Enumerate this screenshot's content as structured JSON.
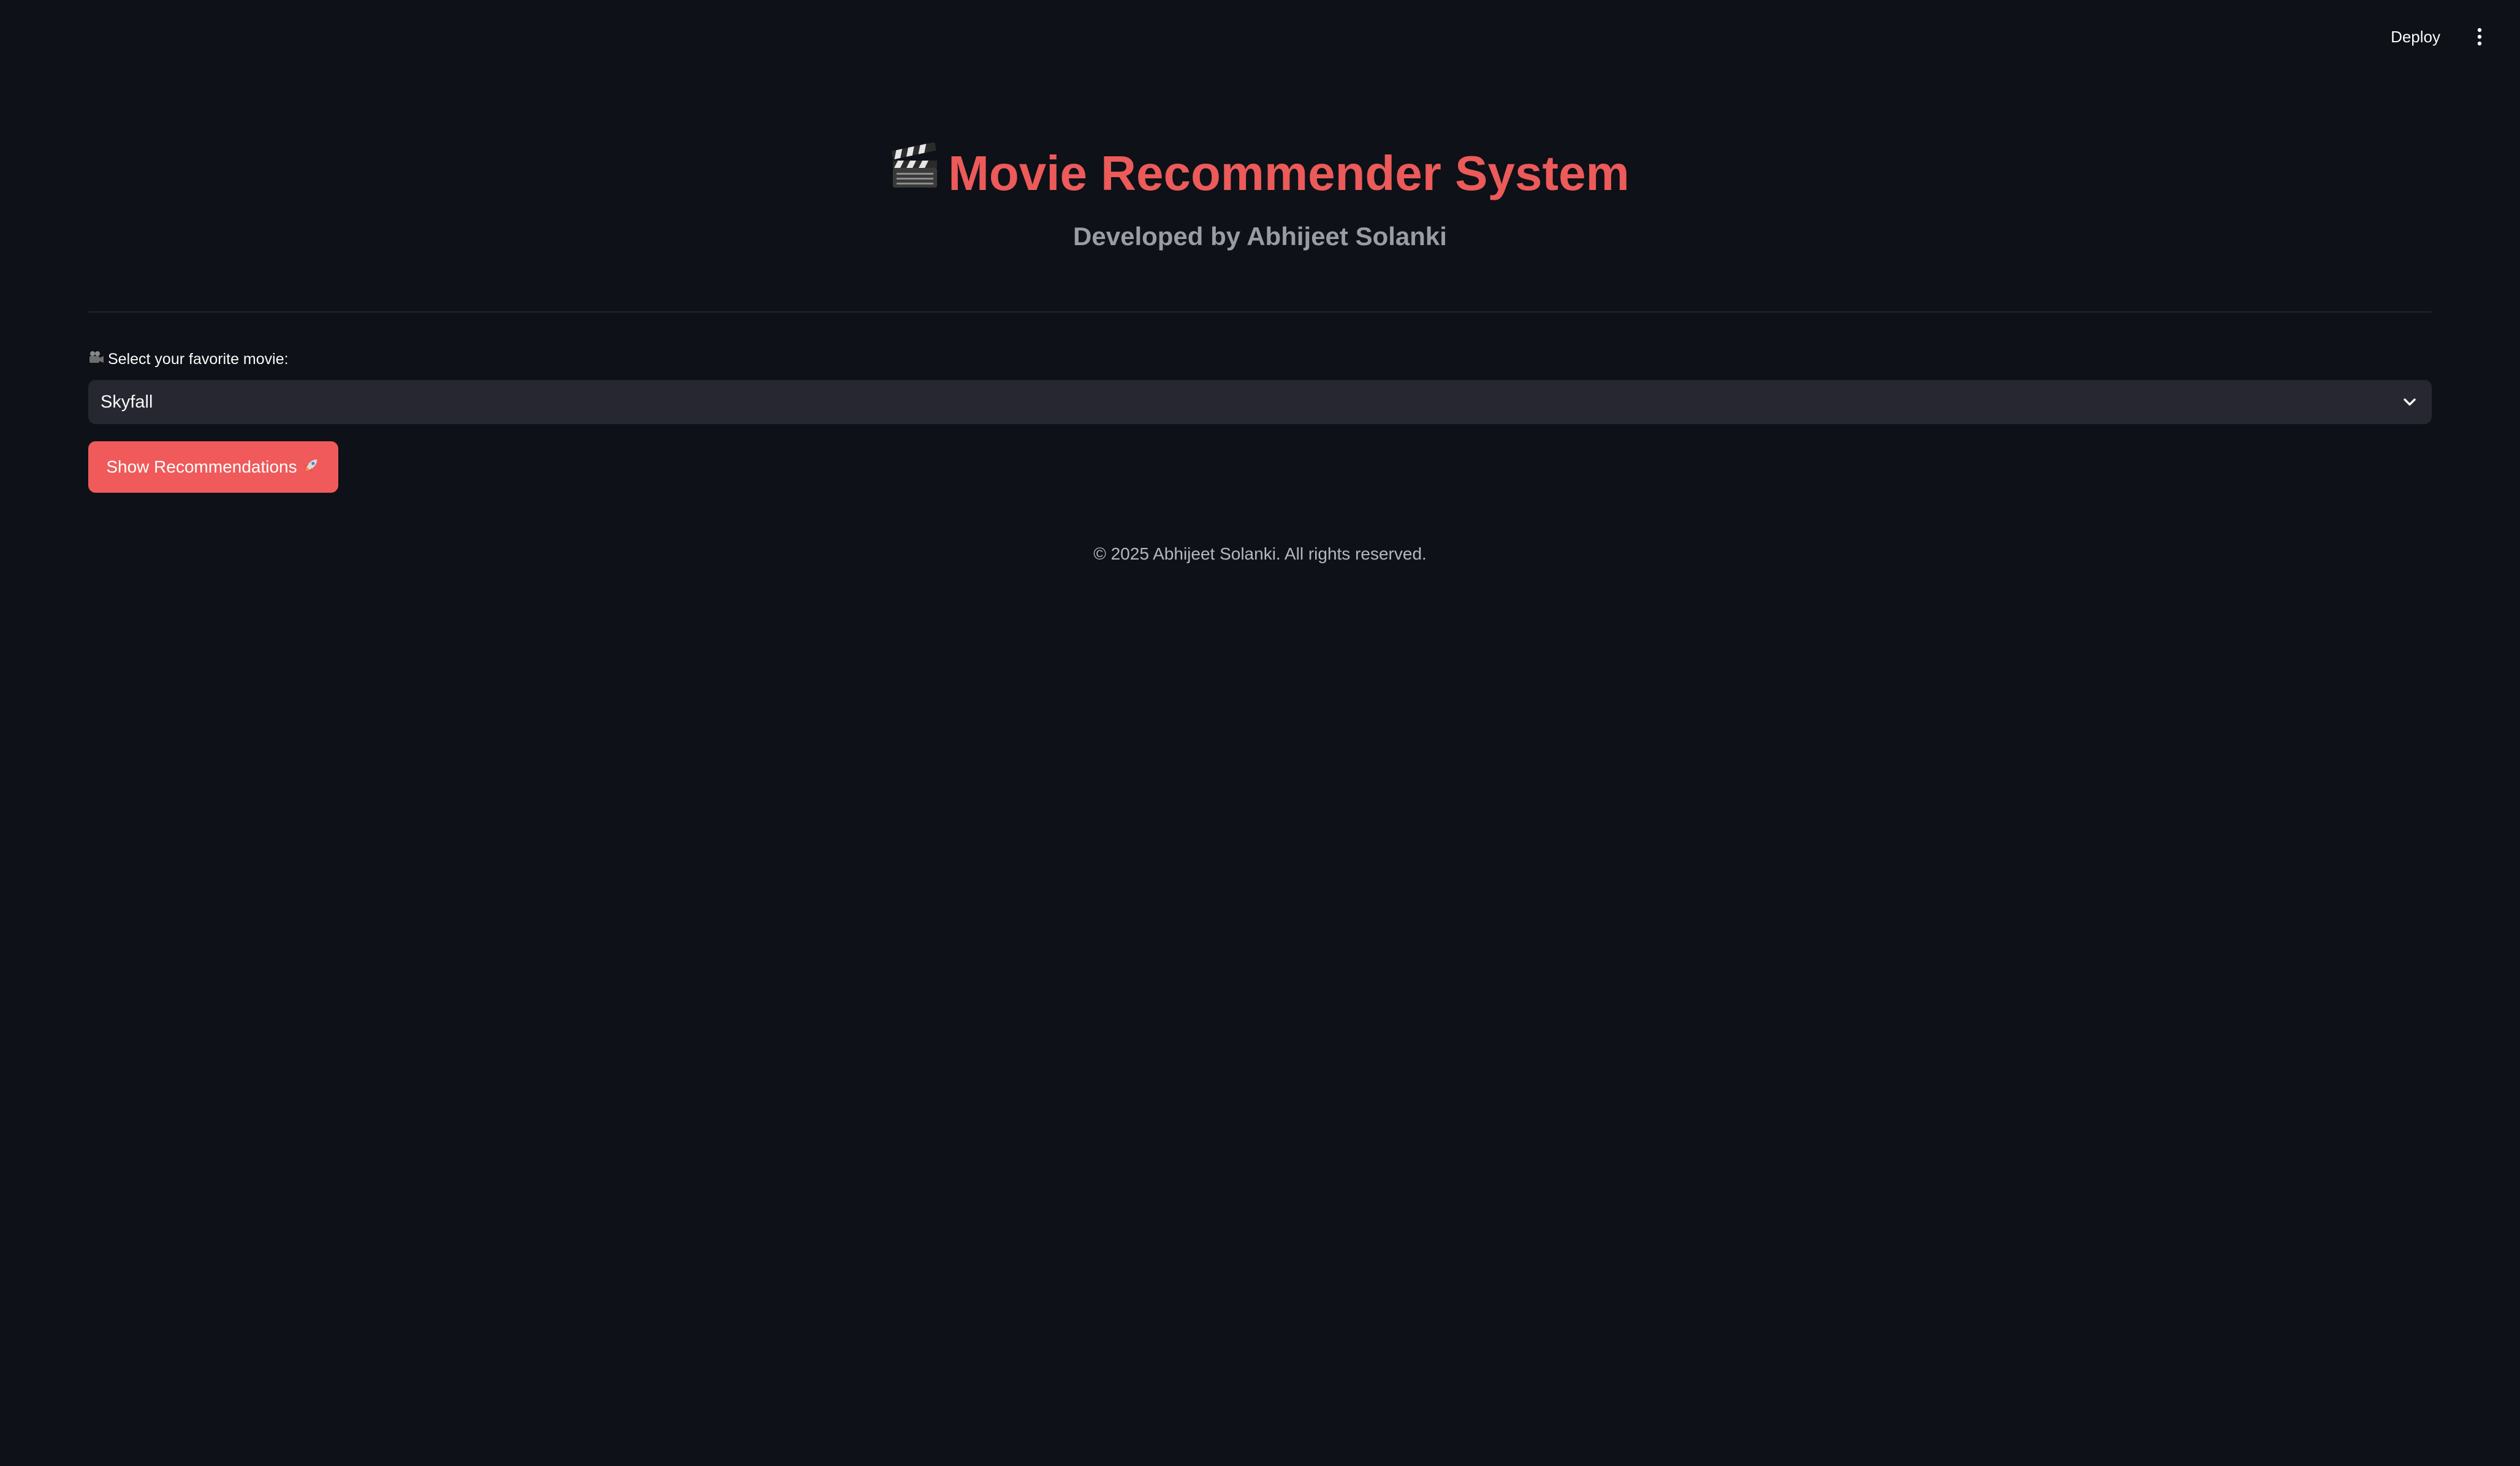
{
  "header": {
    "deploy_label": "Deploy",
    "menu_icon": "vertical-ellipsis-icon"
  },
  "main": {
    "title": "Movie Recommender System",
    "title_icon": "clapper-board-icon",
    "subtitle": "Developed by Abhijeet Solanki",
    "select_label": "Select your favorite movie:",
    "select_label_icon": "movie-camera-icon",
    "selected_movie": "Skyfall",
    "button_label": "Show Recommendations",
    "button_icon": "rocket-icon",
    "footer": "© 2025 Abhijeet Solanki. All rights reserved."
  },
  "colors": {
    "background": "#0e1117",
    "accent": "#f05a5a",
    "title": "#ec5a5a",
    "input_bg": "#262730",
    "muted_text": "#9a9ca3"
  }
}
